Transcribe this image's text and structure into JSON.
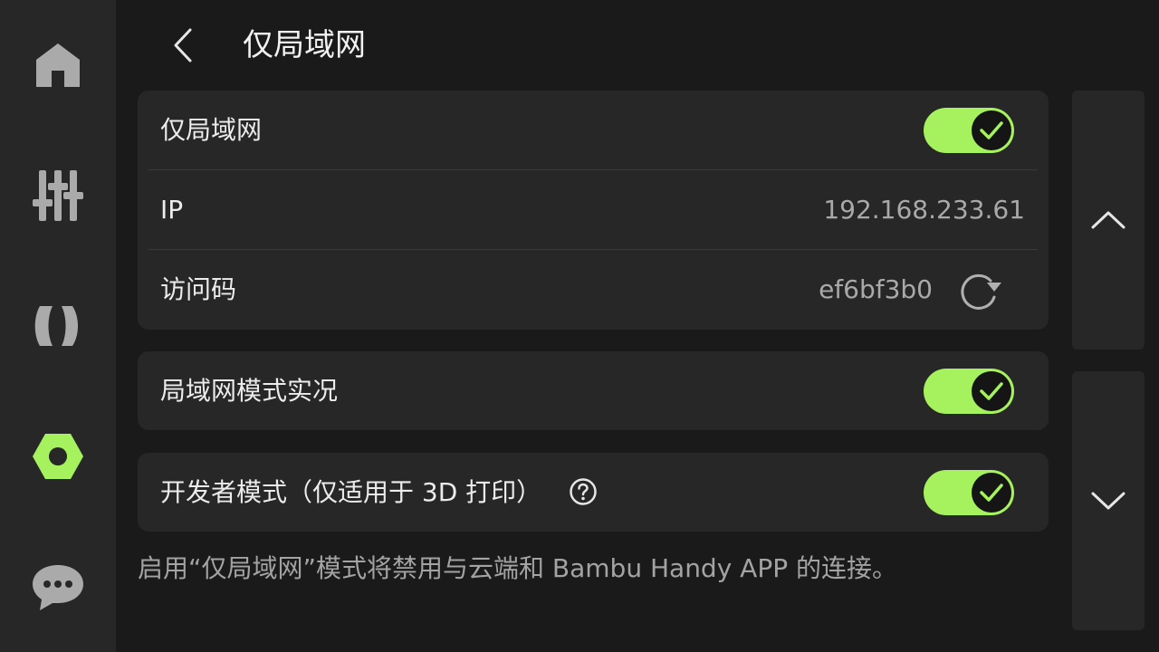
{
  "header": {
    "title": "仅局域网"
  },
  "lan_card": {
    "lan_only_label": "仅局域网",
    "lan_only_on": true,
    "ip_label": "IP",
    "ip_value": "192.168.233.61",
    "access_code_label": "访问码",
    "access_code_value": "ef6bf3b0"
  },
  "liveview_card": {
    "label": "局域网模式实况",
    "on": true
  },
  "developer_card": {
    "label": "开发者模式（仅适用于 3D 打印）",
    "on": true
  },
  "footnote": "启用“仅局域网”模式将禁用与云端和 Bambu Handy APP 的连接。",
  "sidebar": {
    "items": [
      {
        "icon": "home-icon",
        "active": false
      },
      {
        "icon": "controls-icon",
        "active": false
      },
      {
        "icon": "filament-icon",
        "active": false
      },
      {
        "icon": "settings-icon",
        "active": true
      },
      {
        "icon": "chat-icon",
        "active": false
      }
    ]
  },
  "colors": {
    "accent": "#a6f25e",
    "background": "#1a1a1a",
    "card": "#272727",
    "sidebar": "#272727",
    "icon_inactive": "#aaaaaa"
  }
}
